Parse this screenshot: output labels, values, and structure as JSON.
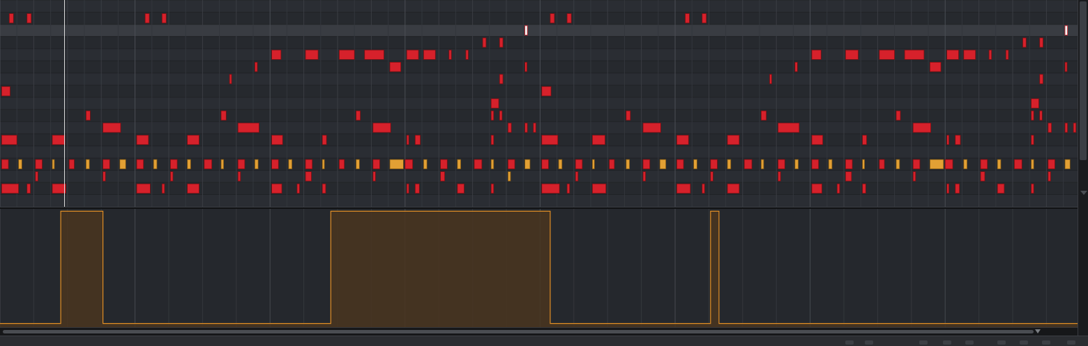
{
  "app": {
    "view": "piano-roll",
    "colors": {
      "grid_bg": "#2a2d33",
      "grid_row_dark": "#26292e",
      "grid_line": "#33363c",
      "bar_line": "#4a4d54",
      "note_red": "#d6212b",
      "note_gold": "#e2a034",
      "event_fill": "#4a3520",
      "event_stroke": "#e08e25",
      "playhead": "#dcdcdc"
    },
    "icons": {
      "scroll_up": "chevron-up-icon",
      "scroll_down": "chevron-down-icon",
      "h_scroll": "caret-down-icon"
    }
  },
  "piano_roll": {
    "rows": 17,
    "highlighted_row": 2,
    "playhead_step": 3.8,
    "steps_per_bar": 8,
    "notes": [
      {
        "row": 1,
        "start": 0.55,
        "len": 0.25,
        "c": "r"
      },
      {
        "row": 1,
        "start": 1.6,
        "len": 0.25,
        "c": "r"
      },
      {
        "row": 1,
        "start": 8.6,
        "len": 0.25,
        "c": "r"
      },
      {
        "row": 1,
        "start": 9.6,
        "len": 0.25,
        "c": "r"
      },
      {
        "row": 1,
        "start": 32.6,
        "len": 0.25,
        "c": "r"
      },
      {
        "row": 1,
        "start": 33.6,
        "len": 0.25,
        "c": "r"
      },
      {
        "row": 1,
        "start": 40.6,
        "len": 0.25,
        "c": "r"
      },
      {
        "row": 1,
        "start": 41.6,
        "len": 0.25,
        "c": "r"
      },
      {
        "row": 2,
        "start": 31.1,
        "len": 0.15,
        "c": "w"
      },
      {
        "row": 2,
        "start": 63.1,
        "len": 0.15,
        "c": "w"
      },
      {
        "row": 3,
        "start": 28.6,
        "len": 0.2,
        "c": "r"
      },
      {
        "row": 3,
        "start": 29.6,
        "len": 0.2,
        "c": "r"
      },
      {
        "row": 3,
        "start": 60.6,
        "len": 0.2,
        "c": "r"
      },
      {
        "row": 3,
        "start": 61.6,
        "len": 0.2,
        "c": "r"
      },
      {
        "row": 4,
        "start": 16.1,
        "len": 0.55,
        "c": "r"
      },
      {
        "row": 4,
        "start": 18.1,
        "len": 0.75,
        "c": "r"
      },
      {
        "row": 4,
        "start": 20.1,
        "len": 0.9,
        "c": "r"
      },
      {
        "row": 4,
        "start": 21.6,
        "len": 1.15,
        "c": "r"
      },
      {
        "row": 4,
        "start": 24.1,
        "len": 0.7,
        "c": "r"
      },
      {
        "row": 4,
        "start": 25.1,
        "len": 0.7,
        "c": "r"
      },
      {
        "row": 4,
        "start": 26.6,
        "len": 0.15,
        "c": "r"
      },
      {
        "row": 4,
        "start": 27.6,
        "len": 0.15,
        "c": "r"
      },
      {
        "row": 4,
        "start": 48.1,
        "len": 0.55,
        "c": "r"
      },
      {
        "row": 4,
        "start": 50.1,
        "len": 0.75,
        "c": "r"
      },
      {
        "row": 4,
        "start": 52.1,
        "len": 0.9,
        "c": "r"
      },
      {
        "row": 4,
        "start": 53.6,
        "len": 1.15,
        "c": "r"
      },
      {
        "row": 4,
        "start": 56.1,
        "len": 0.7,
        "c": "r"
      },
      {
        "row": 4,
        "start": 57.1,
        "len": 0.7,
        "c": "r"
      },
      {
        "row": 4,
        "start": 58.6,
        "len": 0.15,
        "c": "r"
      },
      {
        "row": 4,
        "start": 59.6,
        "len": 0.15,
        "c": "r"
      },
      {
        "row": 5,
        "start": 15.1,
        "len": 0.15,
        "c": "r"
      },
      {
        "row": 5,
        "start": 23.1,
        "len": 0.65,
        "c": "r"
      },
      {
        "row": 5,
        "start": 31.1,
        "len": 0.1,
        "c": "r"
      },
      {
        "row": 5,
        "start": 47.1,
        "len": 0.15,
        "c": "r"
      },
      {
        "row": 5,
        "start": 55.1,
        "len": 0.65,
        "c": "r"
      },
      {
        "row": 5,
        "start": 63.1,
        "len": 0.1,
        "c": "r"
      },
      {
        "row": 6,
        "start": 13.6,
        "len": 0.1,
        "c": "r"
      },
      {
        "row": 6,
        "start": 29.6,
        "len": 0.2,
        "c": "r"
      },
      {
        "row": 6,
        "start": 45.6,
        "len": 0.1,
        "c": "r"
      },
      {
        "row": 6,
        "start": 61.6,
        "len": 0.2,
        "c": "r"
      },
      {
        "row": 7,
        "start": 0.1,
        "len": 0.5,
        "c": "r"
      },
      {
        "row": 7,
        "start": 32.1,
        "len": 0.55,
        "c": "r"
      },
      {
        "row": 8,
        "start": 29.1,
        "len": 0.45,
        "c": "r"
      },
      {
        "row": 8,
        "start": 61.1,
        "len": 0.45,
        "c": "r"
      },
      {
        "row": 9,
        "start": 5.1,
        "len": 0.25,
        "c": "r"
      },
      {
        "row": 9,
        "start": 13.1,
        "len": 0.3,
        "c": "r"
      },
      {
        "row": 9,
        "start": 21.1,
        "len": 0.25,
        "c": "r"
      },
      {
        "row": 9,
        "start": 29.1,
        "len": 0.15,
        "c": "r"
      },
      {
        "row": 9,
        "start": 29.6,
        "len": 0.15,
        "c": "r"
      },
      {
        "row": 9,
        "start": 37.1,
        "len": 0.25,
        "c": "r"
      },
      {
        "row": 9,
        "start": 45.1,
        "len": 0.3,
        "c": "r"
      },
      {
        "row": 9,
        "start": 53.1,
        "len": 0.25,
        "c": "r"
      },
      {
        "row": 9,
        "start": 61.1,
        "len": 0.15,
        "c": "r"
      },
      {
        "row": 9,
        "start": 61.6,
        "len": 0.15,
        "c": "r"
      },
      {
        "row": 10,
        "start": 6.1,
        "len": 1.05,
        "c": "r"
      },
      {
        "row": 10,
        "start": 14.1,
        "len": 1.25,
        "c": "r"
      },
      {
        "row": 10,
        "start": 22.1,
        "len": 1.05,
        "c": "r"
      },
      {
        "row": 10,
        "start": 30.1,
        "len": 0.2,
        "c": "r"
      },
      {
        "row": 10,
        "start": 31.1,
        "len": 0.15,
        "c": "r"
      },
      {
        "row": 10,
        "start": 31.6,
        "len": 0.15,
        "c": "r"
      },
      {
        "row": 10,
        "start": 38.1,
        "len": 1.05,
        "c": "r"
      },
      {
        "row": 10,
        "start": 46.1,
        "len": 1.25,
        "c": "r"
      },
      {
        "row": 10,
        "start": 54.1,
        "len": 1.05,
        "c": "r"
      },
      {
        "row": 10,
        "start": 62.1,
        "len": 0.2,
        "c": "r"
      },
      {
        "row": 10,
        "start": 63.1,
        "len": 0.15,
        "c": "r"
      },
      {
        "row": 10,
        "start": 63.6,
        "len": 0.15,
        "c": "r"
      },
      {
        "row": 11,
        "start": 0.1,
        "len": 0.9,
        "c": "r"
      },
      {
        "row": 11,
        "start": 3.1,
        "len": 0.75,
        "c": "r"
      },
      {
        "row": 11,
        "start": 8.1,
        "len": 0.7,
        "c": "r"
      },
      {
        "row": 11,
        "start": 11.1,
        "len": 0.7,
        "c": "r"
      },
      {
        "row": 11,
        "start": 16.1,
        "len": 0.65,
        "c": "r"
      },
      {
        "row": 11,
        "start": 19.1,
        "len": 0.25,
        "c": "r"
      },
      {
        "row": 11,
        "start": 24.1,
        "len": 0.1,
        "c": "r"
      },
      {
        "row": 11,
        "start": 24.6,
        "len": 0.3,
        "c": "r"
      },
      {
        "row": 11,
        "start": 29.1,
        "len": 0.15,
        "c": "r"
      },
      {
        "row": 11,
        "start": 32.1,
        "len": 0.95,
        "c": "r"
      },
      {
        "row": 11,
        "start": 35.1,
        "len": 0.75,
        "c": "r"
      },
      {
        "row": 11,
        "start": 40.1,
        "len": 0.7,
        "c": "r"
      },
      {
        "row": 11,
        "start": 43.1,
        "len": 0.7,
        "c": "r"
      },
      {
        "row": 11,
        "start": 48.1,
        "len": 0.65,
        "c": "r"
      },
      {
        "row": 11,
        "start": 51.1,
        "len": 0.25,
        "c": "r"
      },
      {
        "row": 11,
        "start": 56.1,
        "len": 0.1,
        "c": "r"
      },
      {
        "row": 11,
        "start": 56.6,
        "len": 0.3,
        "c": "r"
      },
      {
        "row": 11,
        "start": 61.1,
        "len": 0.15,
        "c": "r"
      },
      {
        "row": 13,
        "start": 0.1,
        "len": 0.4,
        "c": "r"
      },
      {
        "row": 13,
        "start": 1.1,
        "len": 0.2,
        "c": "g"
      },
      {
        "row": 13,
        "start": 2.1,
        "len": 0.4,
        "c": "r"
      },
      {
        "row": 13,
        "start": 3.1,
        "len": 0.1,
        "c": "g"
      },
      {
        "row": 13,
        "start": 4.1,
        "len": 0.3,
        "c": "r"
      },
      {
        "row": 13,
        "start": 5.1,
        "len": 0.2,
        "c": "g"
      },
      {
        "row": 13,
        "start": 6.1,
        "len": 0.4,
        "c": "r"
      },
      {
        "row": 13,
        "start": 7.1,
        "len": 0.35,
        "c": "g"
      },
      {
        "row": 13,
        "start": 8.1,
        "len": 0.4,
        "c": "r"
      },
      {
        "row": 13,
        "start": 9.1,
        "len": 0.2,
        "c": "g"
      },
      {
        "row": 13,
        "start": 10.1,
        "len": 0.4,
        "c": "r"
      },
      {
        "row": 13,
        "start": 11.1,
        "len": 0.2,
        "c": "g"
      },
      {
        "row": 13,
        "start": 12.1,
        "len": 0.45,
        "c": "r"
      },
      {
        "row": 13,
        "start": 13.1,
        "len": 0.15,
        "c": "g"
      },
      {
        "row": 13,
        "start": 14.1,
        "len": 0.4,
        "c": "r"
      },
      {
        "row": 13,
        "start": 15.1,
        "len": 0.2,
        "c": "g"
      },
      {
        "row": 13,
        "start": 16.1,
        "len": 0.4,
        "c": "r"
      },
      {
        "row": 13,
        "start": 17.1,
        "len": 0.2,
        "c": "g"
      },
      {
        "row": 13,
        "start": 18.1,
        "len": 0.4,
        "c": "r"
      },
      {
        "row": 13,
        "start": 19.1,
        "len": 0.1,
        "c": "g"
      },
      {
        "row": 13,
        "start": 20.1,
        "len": 0.3,
        "c": "r"
      },
      {
        "row": 13,
        "start": 21.1,
        "len": 0.2,
        "c": "g"
      },
      {
        "row": 13,
        "start": 22.1,
        "len": 0.4,
        "c": "r"
      },
      {
        "row": 13,
        "start": 23.1,
        "len": 0.8,
        "c": "g"
      },
      {
        "row": 13,
        "start": 24.0,
        "len": 0.45,
        "c": "r"
      },
      {
        "row": 13,
        "start": 25.1,
        "len": 0.2,
        "c": "g"
      },
      {
        "row": 13,
        "start": 26.1,
        "len": 0.4,
        "c": "r"
      },
      {
        "row": 13,
        "start": 27.1,
        "len": 0.2,
        "c": "g"
      },
      {
        "row": 13,
        "start": 28.1,
        "len": 0.45,
        "c": "r"
      },
      {
        "row": 13,
        "start": 29.1,
        "len": 0.15,
        "c": "g"
      },
      {
        "row": 13,
        "start": 30.1,
        "len": 0.4,
        "c": "r"
      },
      {
        "row": 13,
        "start": 31.1,
        "len": 0.3,
        "c": "g"
      },
      {
        "row": 13,
        "start": 32.1,
        "len": 0.4,
        "c": "r"
      },
      {
        "row": 13,
        "start": 33.1,
        "len": 0.2,
        "c": "g"
      },
      {
        "row": 13,
        "start": 34.1,
        "len": 0.4,
        "c": "r"
      },
      {
        "row": 13,
        "start": 35.1,
        "len": 0.1,
        "c": "g"
      },
      {
        "row": 13,
        "start": 36.1,
        "len": 0.3,
        "c": "r"
      },
      {
        "row": 13,
        "start": 37.1,
        "len": 0.2,
        "c": "g"
      },
      {
        "row": 13,
        "start": 38.1,
        "len": 0.4,
        "c": "r"
      },
      {
        "row": 13,
        "start": 39.1,
        "len": 0.35,
        "c": "g"
      },
      {
        "row": 13,
        "start": 40.1,
        "len": 0.4,
        "c": "r"
      },
      {
        "row": 13,
        "start": 41.1,
        "len": 0.2,
        "c": "g"
      },
      {
        "row": 13,
        "start": 42.1,
        "len": 0.4,
        "c": "r"
      },
      {
        "row": 13,
        "start": 43.1,
        "len": 0.2,
        "c": "g"
      },
      {
        "row": 13,
        "start": 44.1,
        "len": 0.45,
        "c": "r"
      },
      {
        "row": 13,
        "start": 45.1,
        "len": 0.15,
        "c": "g"
      },
      {
        "row": 13,
        "start": 46.1,
        "len": 0.4,
        "c": "r"
      },
      {
        "row": 13,
        "start": 47.1,
        "len": 0.2,
        "c": "g"
      },
      {
        "row": 13,
        "start": 48.1,
        "len": 0.4,
        "c": "r"
      },
      {
        "row": 13,
        "start": 49.1,
        "len": 0.2,
        "c": "g"
      },
      {
        "row": 13,
        "start": 50.1,
        "len": 0.4,
        "c": "r"
      },
      {
        "row": 13,
        "start": 51.1,
        "len": 0.1,
        "c": "g"
      },
      {
        "row": 13,
        "start": 52.1,
        "len": 0.3,
        "c": "r"
      },
      {
        "row": 13,
        "start": 53.1,
        "len": 0.2,
        "c": "g"
      },
      {
        "row": 13,
        "start": 54.1,
        "len": 0.4,
        "c": "r"
      },
      {
        "row": 13,
        "start": 55.1,
        "len": 0.8,
        "c": "g"
      },
      {
        "row": 13,
        "start": 56.0,
        "len": 0.45,
        "c": "r"
      },
      {
        "row": 13,
        "start": 57.1,
        "len": 0.2,
        "c": "g"
      },
      {
        "row": 13,
        "start": 58.1,
        "len": 0.4,
        "c": "r"
      },
      {
        "row": 13,
        "start": 59.1,
        "len": 0.2,
        "c": "g"
      },
      {
        "row": 13,
        "start": 60.1,
        "len": 0.45,
        "c": "r"
      },
      {
        "row": 13,
        "start": 61.1,
        "len": 0.15,
        "c": "g"
      },
      {
        "row": 13,
        "start": 62.1,
        "len": 0.4,
        "c": "r"
      },
      {
        "row": 13,
        "start": 63.1,
        "len": 0.3,
        "c": "g"
      },
      {
        "row": 14,
        "start": 2.1,
        "len": 0.15,
        "c": "r"
      },
      {
        "row": 14,
        "start": 6.1,
        "len": 0.15,
        "c": "r"
      },
      {
        "row": 14,
        "start": 10.1,
        "len": 0.15,
        "c": "r"
      },
      {
        "row": 14,
        "start": 14.1,
        "len": 0.15,
        "c": "r"
      },
      {
        "row": 14,
        "start": 18.1,
        "len": 0.35,
        "c": "r"
      },
      {
        "row": 14,
        "start": 22.1,
        "len": 0.15,
        "c": "r"
      },
      {
        "row": 14,
        "start": 26.1,
        "len": 0.25,
        "c": "r"
      },
      {
        "row": 14,
        "start": 30.1,
        "len": 0.15,
        "c": "g"
      },
      {
        "row": 14,
        "start": 34.1,
        "len": 0.15,
        "c": "r"
      },
      {
        "row": 14,
        "start": 38.1,
        "len": 0.15,
        "c": "r"
      },
      {
        "row": 14,
        "start": 42.1,
        "len": 0.15,
        "c": "r"
      },
      {
        "row": 14,
        "start": 46.1,
        "len": 0.15,
        "c": "r"
      },
      {
        "row": 14,
        "start": 50.1,
        "len": 0.35,
        "c": "r"
      },
      {
        "row": 14,
        "start": 54.1,
        "len": 0.15,
        "c": "r"
      },
      {
        "row": 14,
        "start": 58.1,
        "len": 0.25,
        "c": "r"
      },
      {
        "row": 14,
        "start": 62.1,
        "len": 0.15,
        "c": "r"
      },
      {
        "row": 15,
        "start": 0.1,
        "len": 1.0,
        "c": "r"
      },
      {
        "row": 15,
        "start": 1.6,
        "len": 0.2,
        "c": "r"
      },
      {
        "row": 15,
        "start": 3.1,
        "len": 0.8,
        "c": "r"
      },
      {
        "row": 15,
        "start": 8.1,
        "len": 0.8,
        "c": "r"
      },
      {
        "row": 15,
        "start": 9.6,
        "len": 0.15,
        "c": "r"
      },
      {
        "row": 15,
        "start": 11.1,
        "len": 0.7,
        "c": "r"
      },
      {
        "row": 15,
        "start": 16.1,
        "len": 0.6,
        "c": "r"
      },
      {
        "row": 15,
        "start": 17.6,
        "len": 0.15,
        "c": "r"
      },
      {
        "row": 15,
        "start": 19.1,
        "len": 0.2,
        "c": "r"
      },
      {
        "row": 15,
        "start": 24.1,
        "len": 0.1,
        "c": "r"
      },
      {
        "row": 15,
        "start": 24.6,
        "len": 0.25,
        "c": "r"
      },
      {
        "row": 15,
        "start": 27.1,
        "len": 0.4,
        "c": "r"
      },
      {
        "row": 15,
        "start": 29.1,
        "len": 0.15,
        "c": "r"
      },
      {
        "row": 15,
        "start": 32.1,
        "len": 1.05,
        "c": "r"
      },
      {
        "row": 15,
        "start": 33.6,
        "len": 0.15,
        "c": "r"
      },
      {
        "row": 15,
        "start": 35.1,
        "len": 0.8,
        "c": "r"
      },
      {
        "row": 15,
        "start": 40.1,
        "len": 0.8,
        "c": "r"
      },
      {
        "row": 15,
        "start": 41.6,
        "len": 0.15,
        "c": "r"
      },
      {
        "row": 15,
        "start": 43.1,
        "len": 0.7,
        "c": "r"
      },
      {
        "row": 15,
        "start": 48.1,
        "len": 0.6,
        "c": "r"
      },
      {
        "row": 15,
        "start": 49.6,
        "len": 0.15,
        "c": "r"
      },
      {
        "row": 15,
        "start": 51.1,
        "len": 0.2,
        "c": "r"
      },
      {
        "row": 15,
        "start": 56.1,
        "len": 0.1,
        "c": "r"
      },
      {
        "row": 15,
        "start": 56.6,
        "len": 0.25,
        "c": "r"
      },
      {
        "row": 15,
        "start": 59.1,
        "len": 0.4,
        "c": "r"
      },
      {
        "row": 15,
        "start": 61.1,
        "len": 0.15,
        "c": "r"
      }
    ]
  },
  "event_editor": {
    "low_value": 0.02,
    "high_value": 0.98,
    "pulses": [
      {
        "start": 3.6,
        "end": 6.1
      },
      {
        "start": 19.6,
        "end": 32.6
      },
      {
        "start": 42.1,
        "end": 42.6
      }
    ]
  }
}
